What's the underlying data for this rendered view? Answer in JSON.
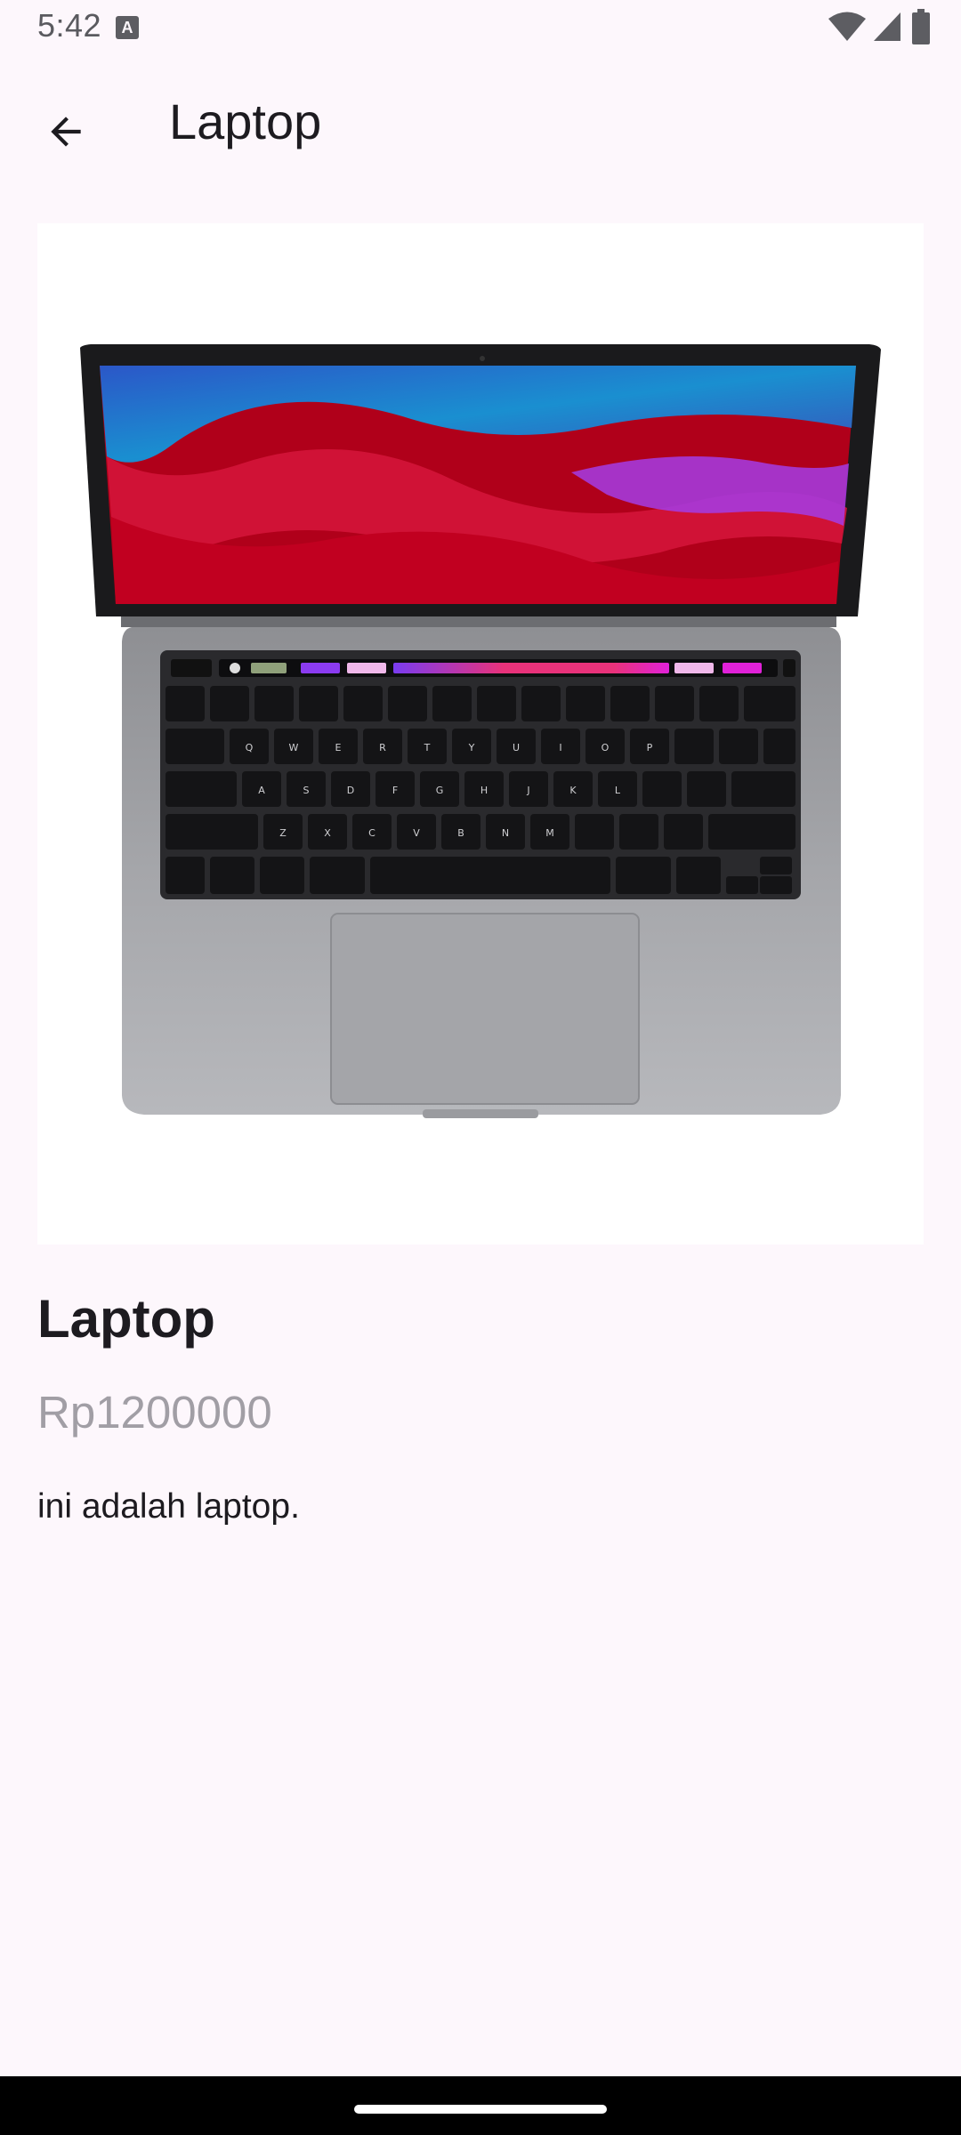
{
  "status_bar": {
    "time": "5:42",
    "notification_icon_letter": "A",
    "icons": [
      "wifi-icon",
      "signal-icon",
      "battery-icon"
    ]
  },
  "app_bar": {
    "back_icon": "arrow-back-icon",
    "title": "Laptop"
  },
  "product": {
    "image_subject": "laptop-image",
    "name": "Laptop",
    "price": "Rp1200000",
    "description": "ini adalah laptop."
  },
  "colors": {
    "background": "#fdf7fc",
    "text_primary": "#1d1b20",
    "text_price": "#a19ea5",
    "nav_bar": "#000000"
  }
}
